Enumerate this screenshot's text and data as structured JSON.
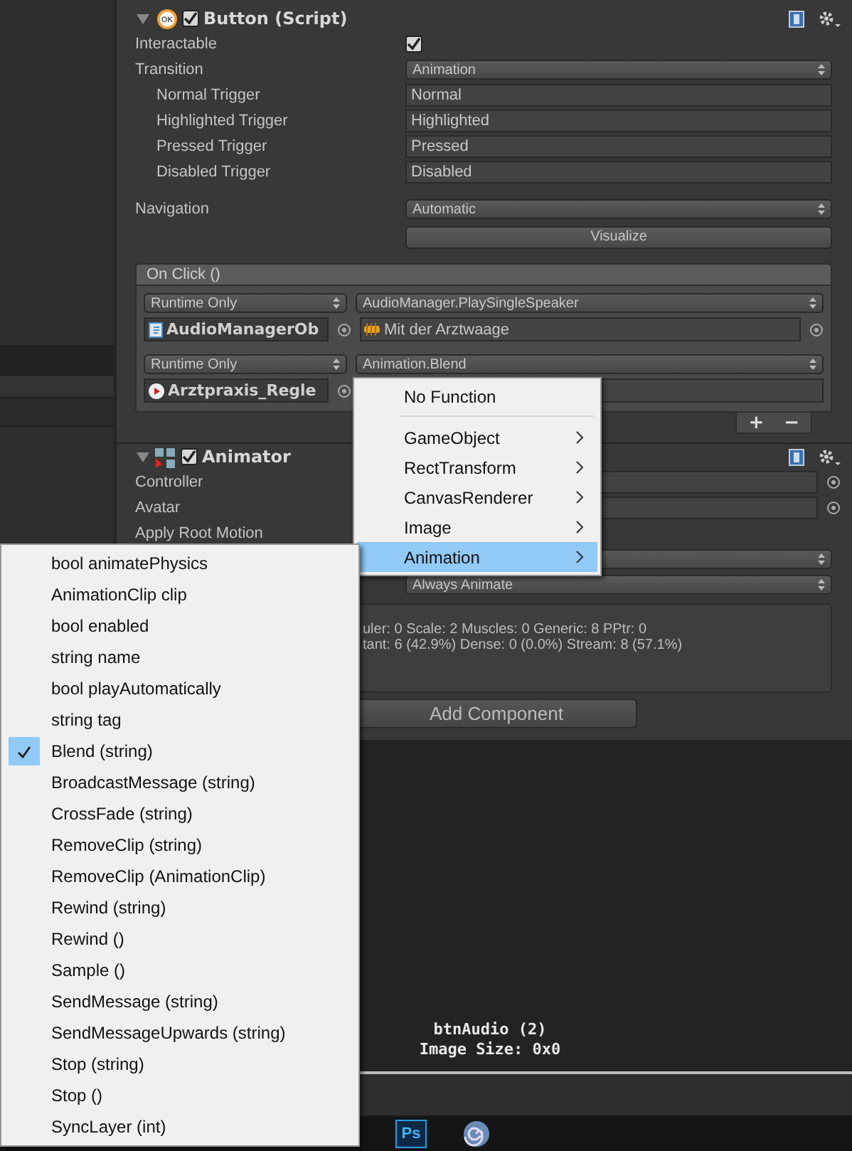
{
  "button_component": {
    "title": "Button (Script)",
    "badge": "OK",
    "enabled": true,
    "expanded": true,
    "fields": [
      {
        "kind": "checkbox",
        "label": "Interactable",
        "checked": true
      },
      {
        "kind": "dropdown",
        "label": "Transition",
        "value": "Animation",
        "children": [
          {
            "kind": "text",
            "label": "Normal Trigger",
            "value": "Normal"
          },
          {
            "kind": "text",
            "label": "Highlighted Trigger",
            "value": "Highlighted"
          },
          {
            "kind": "text",
            "label": "Pressed Trigger",
            "value": "Pressed"
          },
          {
            "kind": "text",
            "label": "Disabled Trigger",
            "value": "Disabled"
          }
        ]
      }
    ],
    "navigation_fields": [
      {
        "kind": "dropdown",
        "label": "Navigation",
        "value": "Automatic"
      },
      {
        "kind": "button",
        "value": "Visualize"
      }
    ],
    "on_click": {
      "title": "On Click ()",
      "add": "+",
      "remove": "−",
      "entries": [
        {
          "mode": "Runtime Only",
          "target": "AudioManagerOb",
          "kind": "script",
          "function": "AudioManager.PlaySingleSpeaker",
          "argument": "Mit der Arztwaage"
        },
        {
          "mode": "Runtime Only",
          "target": "Arztpraxis_Regle",
          "kind": "animation",
          "function": "Animation.Blend"
        }
      ]
    }
  },
  "animator_component": {
    "title": "Animator",
    "enabled": true,
    "expanded": true,
    "fields": [
      {
        "kind": "object",
        "label": "Controller"
      },
      {
        "kind": "object",
        "label": "Avatar"
      },
      {
        "kind": "label",
        "label": "Apply Root Motion"
      },
      {
        "kind": "dropdown"
      },
      {
        "kind": "dropdown",
        "value": "Always Animate"
      }
    ],
    "info": [
      "uler: 0 Scale: 2 Muscles: 0 Generic: 8 PPtr: 0",
      "tant: 6 (42.9%) Dense: 0 (0.0%) Stream: 8 (57.1%)"
    ]
  },
  "add_component": "Add Component",
  "preview": {
    "name": "btnAudio (2)",
    "size": "Image Size: 0x0"
  },
  "taskbar": [
    {
      "kind": "photoshop",
      "label": "Ps"
    },
    {
      "kind": "swirl"
    }
  ],
  "function_menu": {
    "items": [
      {
        "label": "No Function",
        "submenu": false,
        "selected": false
      },
      {
        "label": "GameObject",
        "submenu": true,
        "selected": false
      },
      {
        "label": "RectTransform",
        "submenu": true,
        "selected": false
      },
      {
        "label": "CanvasRenderer",
        "submenu": true,
        "selected": false
      },
      {
        "label": "Image",
        "submenu": true,
        "selected": false
      },
      {
        "label": "Animation",
        "submenu": true,
        "selected": true
      }
    ]
  },
  "animation_submenu": {
    "items": [
      {
        "label": "bool animatePhysics",
        "checked": false
      },
      {
        "label": "AnimationClip clip",
        "checked": false
      },
      {
        "label": "bool enabled",
        "checked": false
      },
      {
        "label": "string name",
        "checked": false
      },
      {
        "label": "bool playAutomatically",
        "checked": false
      },
      {
        "label": "string tag",
        "checked": false
      },
      {
        "label": "Blend (string)",
        "checked": true
      },
      {
        "label": "BroadcastMessage (string)",
        "checked": false
      },
      {
        "label": "CrossFade (string)",
        "checked": false
      },
      {
        "label": "RemoveClip (string)",
        "checked": false
      },
      {
        "label": "RemoveClip (AnimationClip)",
        "checked": false
      },
      {
        "label": "Rewind (string)",
        "checked": false
      },
      {
        "label": "Rewind ()",
        "checked": false
      },
      {
        "label": "Sample ()",
        "checked": false
      },
      {
        "label": "SendMessage (string)",
        "checked": false
      },
      {
        "label": "SendMessageUpwards (string)",
        "checked": false
      },
      {
        "label": "Stop (string)",
        "checked": false
      },
      {
        "label": "Stop ()",
        "checked": false
      },
      {
        "label": "SyncLayer (int)",
        "checked": false
      }
    ]
  }
}
